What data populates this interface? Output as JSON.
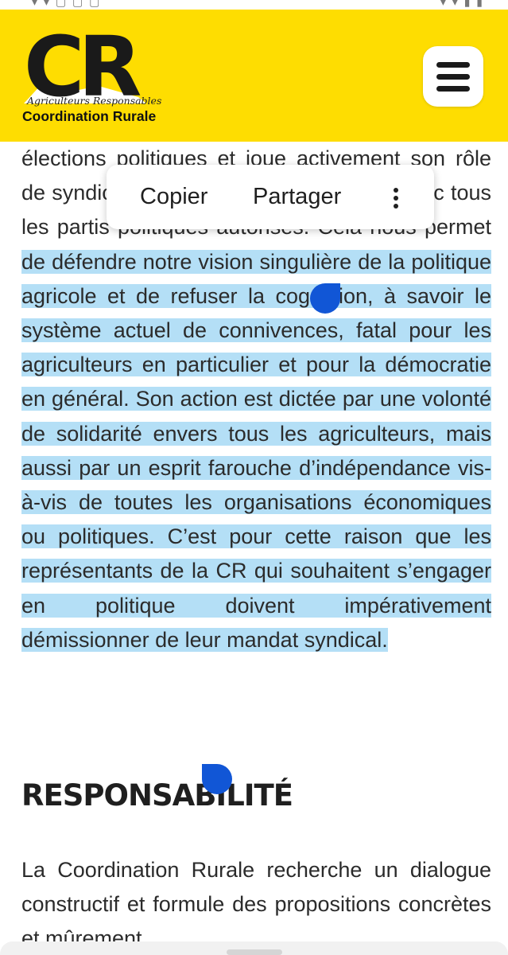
{
  "header": {
    "logo_tagline": "Agriculteurs Responsables",
    "logo_brand": "Coordination Rurale",
    "logo_letters": "CR",
    "logo_colors": {
      "background": "#fedd01",
      "mark": "#1a1a1a"
    },
    "menu_icon": "hamburger-menu-icon"
  },
  "article": {
    "para1_pre": "élections politiques et joue activement son rôle de syndicat représentatif en dialoguant avec tous les partis politiques autorisés. Cela nous permet ",
    "para1_selected": "de défendre notre vision singulière de la politique agricole et de refuser la cogestion, à savoir le système actuel de connivences, fatal pour les agriculteurs en particulier et pour la démocratie en général. Son action est dictée par une volonté de solidarité envers tous les agriculteurs, mais aussi par un esprit farouche d’indépendance vis-à-vis de toutes les organisations économiques ou politiques. C’est pour cette raison que les représentants de la CR qui souhaitent s’engager en politique doivent impérativement démissionner de leur mandat syndical.",
    "heading": "RESPONSABILITÉ",
    "para2": "La Coordination Rurale recherche un dialogue constructif et formule des propositions concrètes et mûrement"
  },
  "selection_menu": {
    "copy_label": "Copier",
    "share_label": "Partager",
    "more_icon": "more-vertical-icon"
  },
  "colors": {
    "selection": "#b4dff6",
    "handle": "#1156d6",
    "text": "#2b2b2b"
  }
}
